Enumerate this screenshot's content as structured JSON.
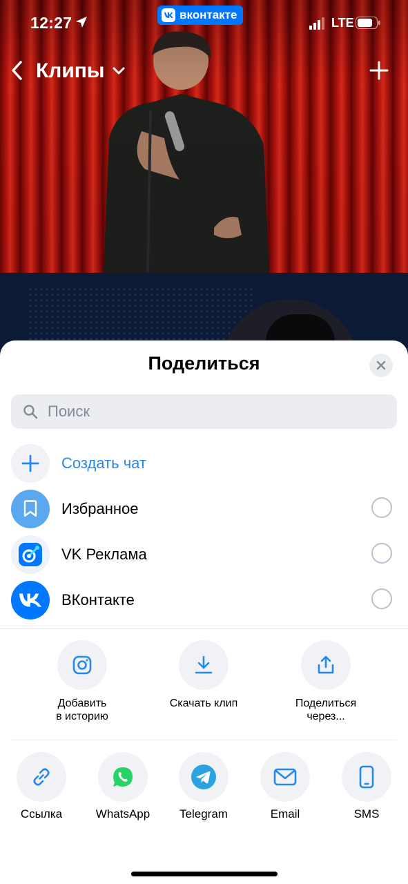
{
  "status_bar": {
    "time": "12:27",
    "app_badge": "вконтакте",
    "network": "LTE"
  },
  "nav": {
    "title": "Клипы"
  },
  "sheet": {
    "title": "Поделиться",
    "search_placeholder": "Поиск",
    "create_chat": "Создать чат",
    "contacts": [
      {
        "label": "Избранное"
      },
      {
        "label": "VK Реклама"
      },
      {
        "label": "ВКонтакте"
      }
    ],
    "actions": [
      {
        "label_line1": "Добавить",
        "label_line2": "в историю"
      },
      {
        "label_line1": "Скачать клип",
        "label_line2": ""
      },
      {
        "label_line1": "Поделиться",
        "label_line2": "через..."
      }
    ],
    "share_targets": [
      {
        "label": "Ссылка"
      },
      {
        "label": "WhatsApp"
      },
      {
        "label": "Telegram"
      },
      {
        "label": "Email"
      },
      {
        "label": "SMS"
      }
    ]
  },
  "colors": {
    "accent": "#0077ff",
    "link_text": "#2688eb",
    "whatsapp": "#25d366",
    "telegram": "#2aa3e0"
  }
}
